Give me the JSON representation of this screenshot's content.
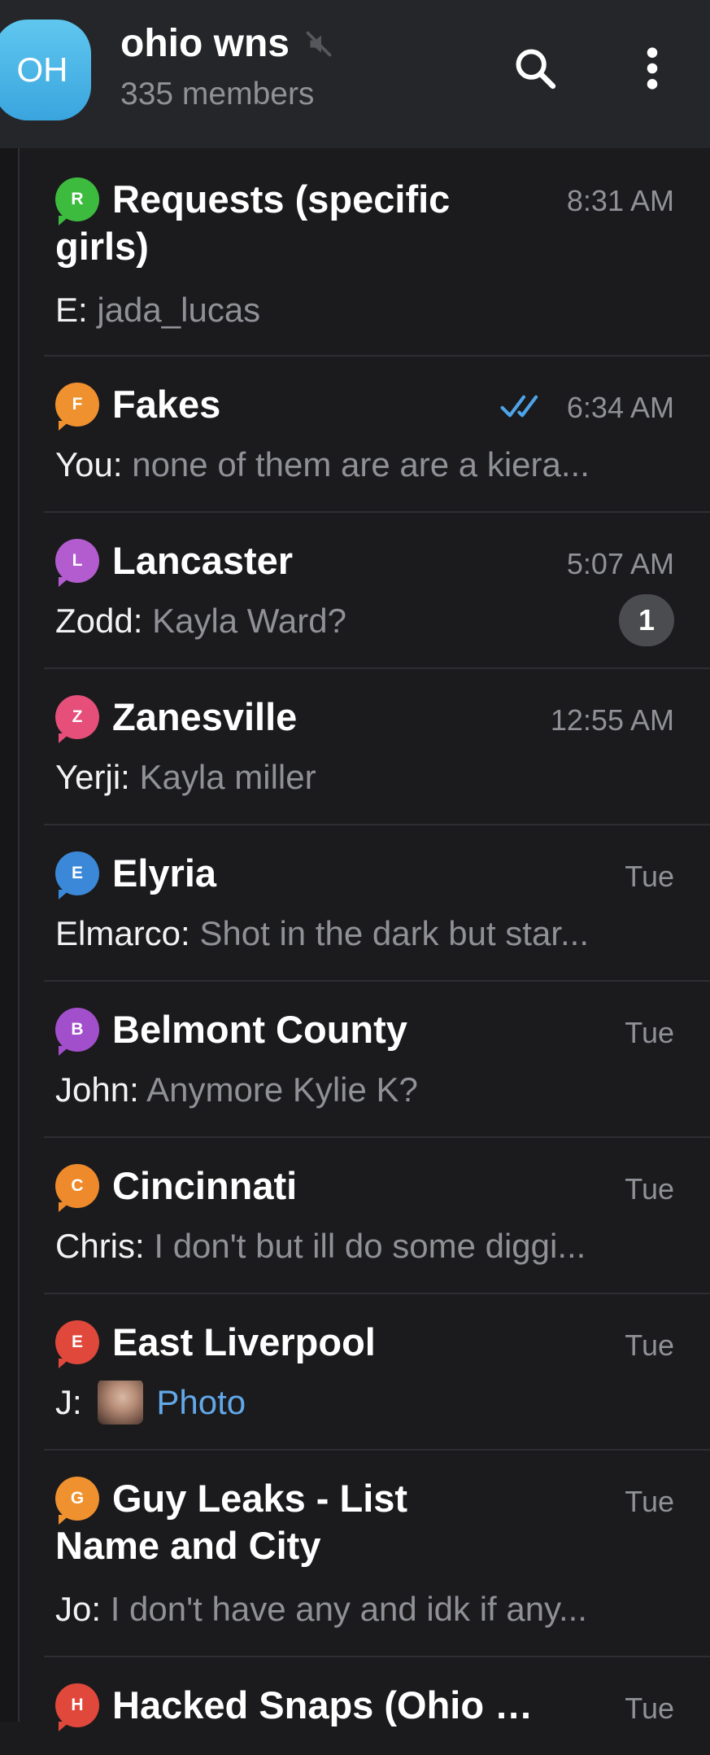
{
  "header": {
    "avatar_text": "OH",
    "avatar_color": "#46b4e6",
    "title": "ohio wns",
    "subtitle": "335 members"
  },
  "colors": {
    "background": "#1b1b1d",
    "header": "#25262a",
    "secondary_text": "#8f9196",
    "link": "#62a8e8",
    "read_check": "#4ea4ea"
  },
  "chats": [
    {
      "icon_letter": "R",
      "icon_color": "#3dbb3f",
      "title": "Requests (specific girls)",
      "time": "8:31 AM",
      "sender": "E: ",
      "preview": "jada_lucas"
    },
    {
      "icon_letter": "F",
      "icon_color": "#f0912f",
      "title": "Fakes",
      "time": "6:34 AM",
      "read_check": true,
      "sender": "You: ",
      "preview": "none of them are are a kiera..."
    },
    {
      "icon_letter": "L",
      "icon_color": "#b25ccf",
      "title": "Lancaster",
      "time": "5:07 AM",
      "sender": "Zodd: ",
      "preview": "Kayla Ward?",
      "unread": "1"
    },
    {
      "icon_letter": "Z",
      "icon_color": "#e54f7a",
      "title": "Zanesville",
      "time": "12:55 AM",
      "sender": "Yerji: ",
      "preview": "Kayla miller"
    },
    {
      "icon_letter": "E",
      "icon_color": "#3b88d8",
      "title": "Elyria",
      "time": "Tue",
      "sender": "Elmarco: ",
      "preview": "Shot in the dark but star..."
    },
    {
      "icon_letter": "B",
      "icon_color": "#a24fcc",
      "title": "Belmont County",
      "time": "Tue",
      "sender": "John: ",
      "preview": "Anymore Kylie K?"
    },
    {
      "icon_letter": "C",
      "icon_color": "#ee8a2c",
      "title": "Cincinnati",
      "time": "Tue",
      "sender": "Chris: ",
      "preview": "I don't but ill do some diggi..."
    },
    {
      "icon_letter": "E",
      "icon_color": "#e0483b",
      "title": "East Liverpool",
      "time": "Tue",
      "sender": "J: ",
      "preview": "Photo",
      "has_photo": true
    },
    {
      "icon_letter": "G",
      "icon_color": "#f0912f",
      "title": "Guy Leaks - List Name and City",
      "time": "Tue",
      "sender": "Jo: ",
      "preview": "I don't have any and idk if any..."
    },
    {
      "icon_letter": "H",
      "icon_color": "#e0483b",
      "title": "Hacked Snaps (Ohio O...",
      "time": "Tue"
    }
  ]
}
